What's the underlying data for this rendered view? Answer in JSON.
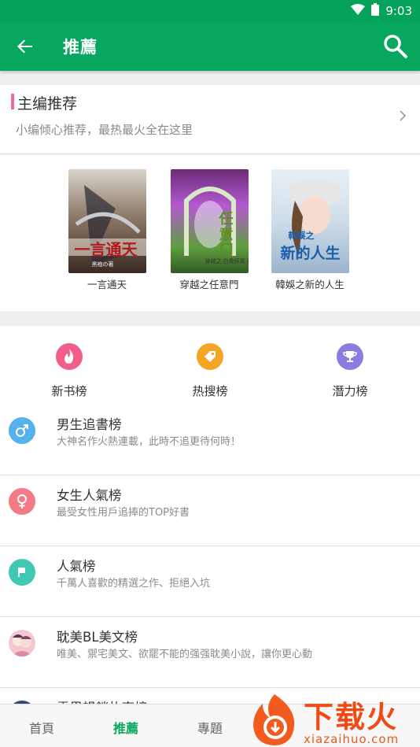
{
  "status_bar": {
    "time": "9:03",
    "wifi_icon": "wifi-icon",
    "battery_icon": "battery-icon"
  },
  "app_bar": {
    "title": "推薦",
    "back_icon": "back-arrow-icon",
    "search_icon": "search-icon"
  },
  "editor_section": {
    "title": "主编推荐",
    "subtitle": "小编倾心推荐，最热最火全在这里"
  },
  "books": [
    {
      "title": "一言通天",
      "cover_title": "一言通天",
      "cover_author": "黑袍の著"
    },
    {
      "title": "穿越之任意門",
      "cover_title": "任意门",
      "cover_author": "穿越之 白骨肝浆 著"
    },
    {
      "title": "韓娛之新的人生",
      "cover_title": "新的人生",
      "cover_author": "韓娛之"
    }
  ],
  "rank_types": [
    {
      "label": "新书榜",
      "icon": "fire-icon",
      "color": "#f25e8a"
    },
    {
      "label": "热搜榜",
      "icon": "tag-icon",
      "color": "#f5a524"
    },
    {
      "label": "潛力榜",
      "icon": "trophy-icon",
      "color": "#8d7ce0"
    }
  ],
  "rank_lists": [
    {
      "title": "男生追書榜",
      "desc": "大神名作火熱連載，此時不追更待何時！",
      "icon": "male-icon",
      "color": "#56b2ec"
    },
    {
      "title": "女生人氣榜",
      "desc": "最受女性用戶追捧的TOP好書",
      "icon": "female-icon",
      "color": "#f37b86"
    },
    {
      "title": "人氣榜",
      "desc": "千萬人喜歡的精選之作、拒絕入坑",
      "icon": "flag-icon",
      "color": "#3fc9b4"
    },
    {
      "title": "耽美BL美文榜",
      "desc": "唯美、禦宅美文、欲罷不能的强强耽美小說，讓你更心動",
      "icon": "bl-avatar-icon",
      "color": "#f4c6d0"
    },
    {
      "title": "雲界暢銷故事榜",
      "desc": "",
      "icon": "cloud-avatar-icon",
      "color": "#2c4a6e"
    }
  ],
  "tabs": [
    {
      "label": "首頁",
      "active": false
    },
    {
      "label": "推薦",
      "active": true
    },
    {
      "label": "專題",
      "active": false
    }
  ],
  "watermark": {
    "brand": "下载火",
    "domain": "xiazaihuo.com"
  }
}
